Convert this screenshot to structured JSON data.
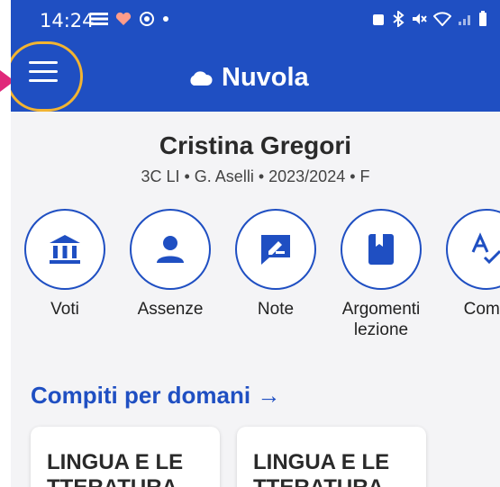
{
  "status": {
    "time": "14:24"
  },
  "app": {
    "title": "Nuvola"
  },
  "student": {
    "name": "Cristina Gregori",
    "meta": "3C LI • G. Aselli • 2023/2024 • F"
  },
  "actions": [
    {
      "label": "Voti",
      "icon": "bank-icon"
    },
    {
      "label": "Assenze",
      "icon": "person-icon"
    },
    {
      "label": "Note",
      "icon": "note-icon"
    },
    {
      "label": "Argomenti lezione",
      "icon": "book-icon"
    },
    {
      "label": "Comp",
      "icon": "spellcheck-icon"
    }
  ],
  "section": {
    "title": "Compiti per domani →"
  },
  "cards": [
    {
      "title": "LINGUA E LE TTERATURA"
    },
    {
      "title": "LINGUA E LE TTERATURA"
    }
  ],
  "colors": {
    "primary": "#1f4fc2",
    "highlight": "#f2b431"
  }
}
